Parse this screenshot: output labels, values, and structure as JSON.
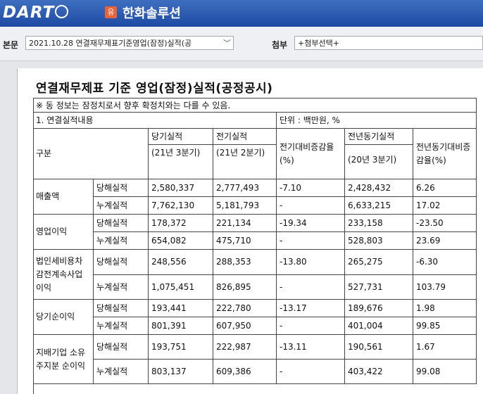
{
  "header": {
    "logo_text": "DART",
    "company_badge": "유",
    "company_name": "한화솔루션"
  },
  "toolbar": {
    "body_label": "본문",
    "body_select": "2021.10.28  연결재무제표기준영업(잠정)실적(공",
    "attach_label": "첨부",
    "attach_select": "+첨부선택+"
  },
  "document": {
    "title": "연결재무제표 기준 영업(잠정)실적(공정공시)",
    "notice": "※ 동 정보는 잠정치로서 향후 확정치와는 다를 수 있음.",
    "section": "1. 연결실적내용",
    "unit": "단위 : 백만원, %",
    "headers": {
      "category": "구분",
      "current": "당기실적",
      "current_sub": "(21년 3분기)",
      "previous": "전기실적",
      "previous_sub": "(21년 2분기)",
      "qoq": "전기대비증감율(%)",
      "yoy_period": "전년동기실적",
      "yoy_period_sub": "(20년 3분기)",
      "yoy": "전년동기대비증감율(%)"
    },
    "rows": [
      {
        "group": "매출액",
        "sub": [
          "당해실적",
          "누계실적"
        ],
        "values": [
          [
            "2,580,337",
            "2,777,493",
            "-7.10",
            "2,428,432",
            "6.26"
          ],
          [
            "7,762,130",
            "5,181,793",
            "-",
            "6,633,215",
            "17.02"
          ]
        ]
      },
      {
        "group": "영업이익",
        "sub": [
          "당해실적",
          "누계실적"
        ],
        "values": [
          [
            "178,372",
            "221,134",
            "-19.34",
            "233,158",
            "-23.50"
          ],
          [
            "654,082",
            "475,710",
            "-",
            "528,803",
            "23.69"
          ]
        ]
      },
      {
        "group": "법인세비용차감전계속사업이익",
        "sub": [
          "당해실적",
          "누계실적"
        ],
        "values": [
          [
            "248,556",
            "288,353",
            "-13.80",
            "265,275",
            "-6.30"
          ],
          [
            "1,075,451",
            "826,895",
            "-",
            "527,731",
            "103.79"
          ]
        ]
      },
      {
        "group": "당기순이익",
        "sub": [
          "당해실적",
          "누계실적"
        ],
        "values": [
          [
            "193,441",
            "222,780",
            "-13.17",
            "189,676",
            "1.98"
          ],
          [
            "801,391",
            "607,950",
            "-",
            "401,004",
            "99.85"
          ]
        ]
      },
      {
        "group": "지배기업 소유주지분 순이익",
        "sub": [
          "당해실적",
          "누계실적"
        ],
        "values": [
          [
            "193,751",
            "222,987",
            "-13.11",
            "190,561",
            "1.67"
          ],
          [
            "803,137",
            "609,386",
            "-",
            "403,422",
            "99.08"
          ]
        ]
      }
    ]
  }
}
